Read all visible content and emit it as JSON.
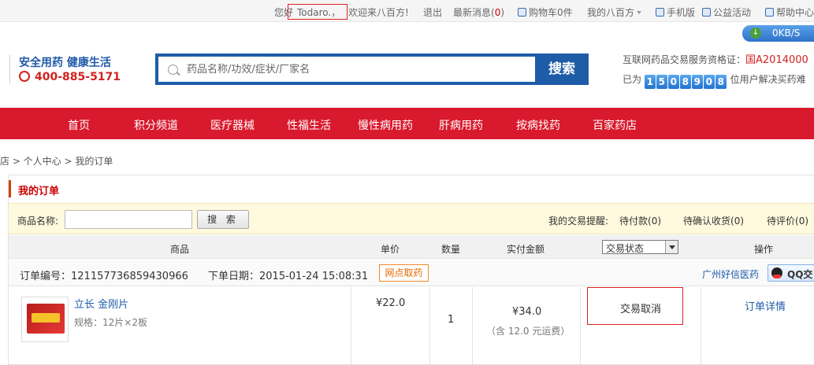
{
  "topbar": {
    "greeting": "您好",
    "username": "Todaro.，",
    "welcome": "欢迎来八百方!",
    "logout": "退出",
    "messages_label": "最新消息(",
    "messages_count": "0",
    "messages_close": ")",
    "cart": "购物车0件",
    "my_account": "我的八百方",
    "mobile": "手机版",
    "charity": "公益活动",
    "help": "帮助中心"
  },
  "speed_widget": {
    "text": "0KB/S"
  },
  "header": {
    "slogan": "安全用药 健康生活",
    "hotline": "400-885-5171",
    "search_placeholder": "药品名称/功效/症状/厂家名",
    "search_button": "搜索",
    "qualification_label": "互联网药品交易服务资格证：",
    "qualification_number": "国A2014000",
    "users_prefix": "已为",
    "users_digits": [
      "1",
      "5",
      "0",
      "8",
      "9",
      "0",
      "8"
    ],
    "users_suffix": "位用户解决买药难"
  },
  "nav": {
    "items": [
      "首页",
      "积分频道",
      "医疗器械",
      "性福生活",
      "慢性病用药",
      "肝病用药",
      "按病找药",
      "百家药店"
    ]
  },
  "breadcrumb": "店 > 个人中心 > 我的订单",
  "orders": {
    "title": "我的订单",
    "filter_label": "商品名称:",
    "filter_value": "",
    "filter_button": "搜 索",
    "reminder_label": "我的交易提醒:",
    "pending_pay_label": "待付款",
    "pending_pay_count": "(0)",
    "pending_receive_label": "待确认收货",
    "pending_receive_count": "(0)",
    "pending_review_label": "待评价",
    "pending_review_count": "(0)",
    "columns": {
      "product": "商品",
      "unit_price": "单价",
      "quantity": "数量",
      "paid": "实付金额",
      "status": "交易状态",
      "actions": "操作"
    },
    "order": {
      "number_label": "订单编号：",
      "number": "121157736859430966",
      "date_label": "下单日期：",
      "date": "2015-01-24 15:08:31",
      "pickup_tag": "网点取药",
      "store": "广州好信医药",
      "qq": "QQ交",
      "product_name": "立长 金刚片",
      "product_spec": "规格：12片×2板",
      "unit_price": "¥22.0",
      "quantity": "1",
      "paid": "¥34.0",
      "shipping_note": "（含 12.0 元运费）",
      "status": "交易取消",
      "detail_link": "订单详情"
    }
  }
}
